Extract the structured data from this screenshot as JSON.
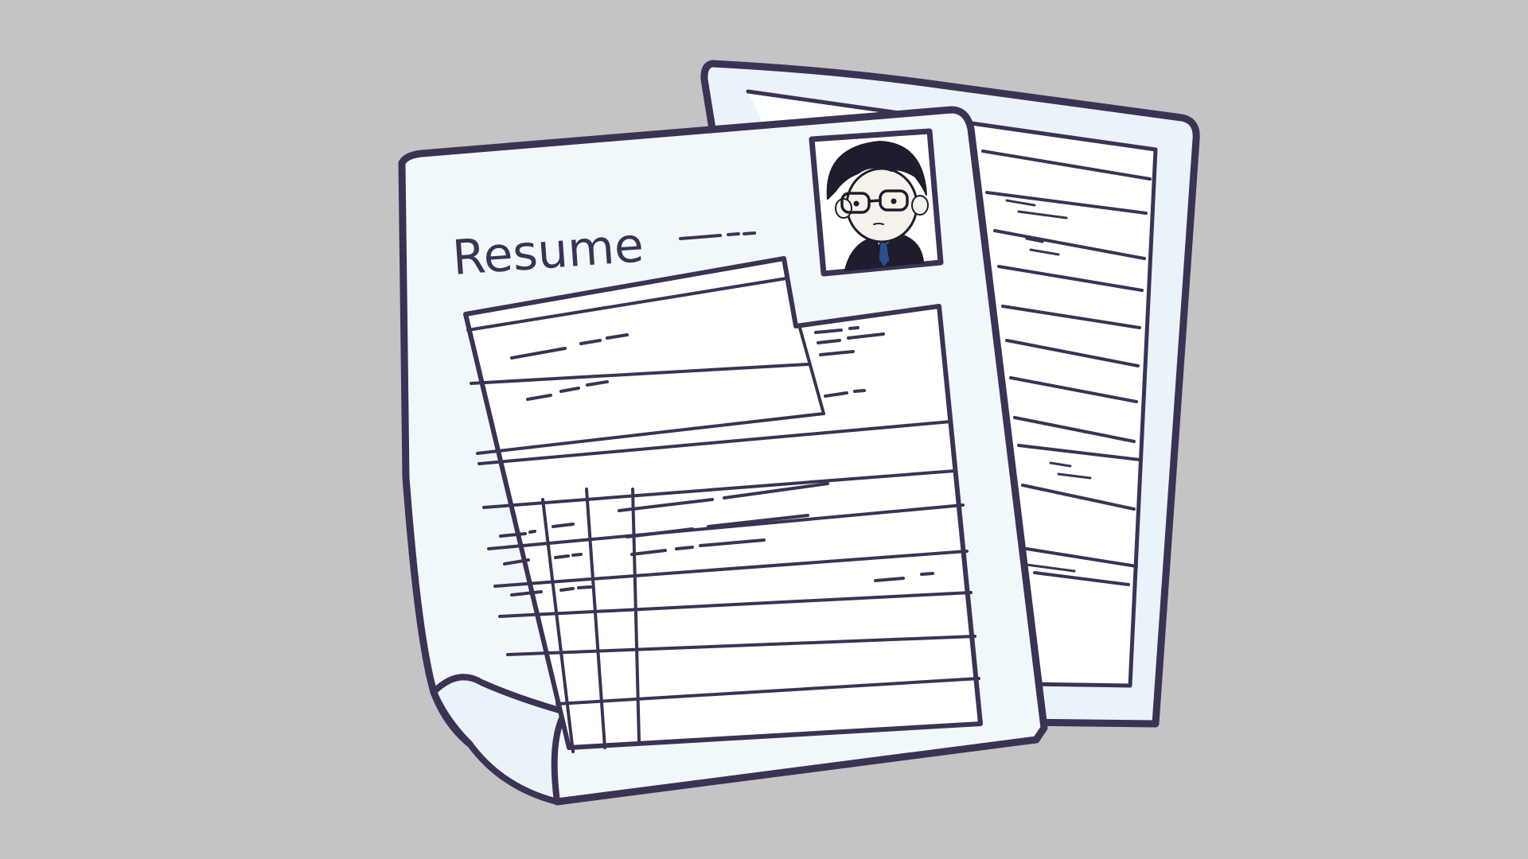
{
  "title_text": "Resume",
  "colors": {
    "background": "#c4c4c4",
    "outline": "#3a3354",
    "paper_front": "#f1f8fb",
    "paper_back": "#e9f3f9",
    "form_area": "#ffffff",
    "hair": "#1f1c2d",
    "skin": "#f6f1ea",
    "tie": "#2a4f92"
  },
  "icons": [
    "front-resume-sheet",
    "back-resume-sheet",
    "photo-frame-icon",
    "person-portrait-icon",
    "folded-corner-icon"
  ]
}
